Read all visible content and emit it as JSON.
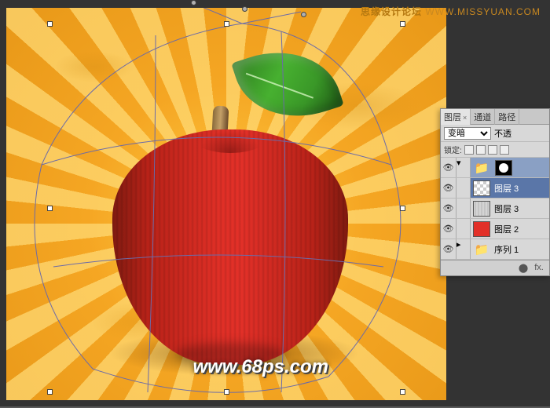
{
  "watermark": {
    "top_cn": "思缘设计论坛",
    "top_url": "WWW.MISSYUAN.COM",
    "bottom": "www.68ps.com"
  },
  "panel": {
    "tabs": {
      "layers": "图层",
      "channels": "通道",
      "paths": "路径"
    },
    "blend_mode": "变暗",
    "opacity_label": "不透",
    "lock_label": "锁定:",
    "layers": [
      {
        "name": "",
        "type": "group-mask"
      },
      {
        "name": "图层 3",
        "type": "current"
      },
      {
        "name": "图层 3",
        "type": "texture"
      },
      {
        "name": "图层 2",
        "type": "fill"
      },
      {
        "name": "序列 1",
        "type": "group"
      }
    ],
    "footer": {
      "link": "⬤",
      "fx": "fx."
    }
  }
}
